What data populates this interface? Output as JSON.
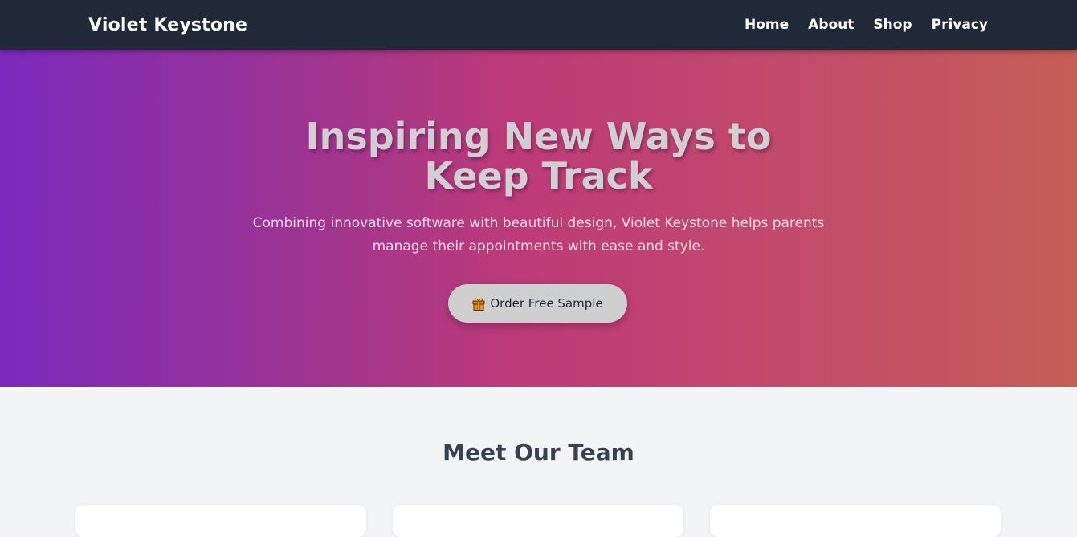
{
  "navbar": {
    "brand": "Violet Keystone",
    "links": [
      "Home",
      "About",
      "Shop",
      "Privacy"
    ]
  },
  "hero": {
    "title": "Inspiring New Ways to Keep Track",
    "subtitle": "Combining innovative software with beautiful design, Violet Keystone helps parents manage their appointments with ease and style.",
    "cta_label": "Order Free Sample",
    "cta_icon": "gift-icon"
  },
  "team": {
    "title": "Meet Our Team"
  },
  "colors": {
    "navbar_bg": "#1f2937",
    "gradient_start": "#7a2abd",
    "gradient_mid": "#bd3a78",
    "gradient_end": "#c55e55",
    "section_bg": "#f3f4f6",
    "heading_dark": "#374151"
  }
}
